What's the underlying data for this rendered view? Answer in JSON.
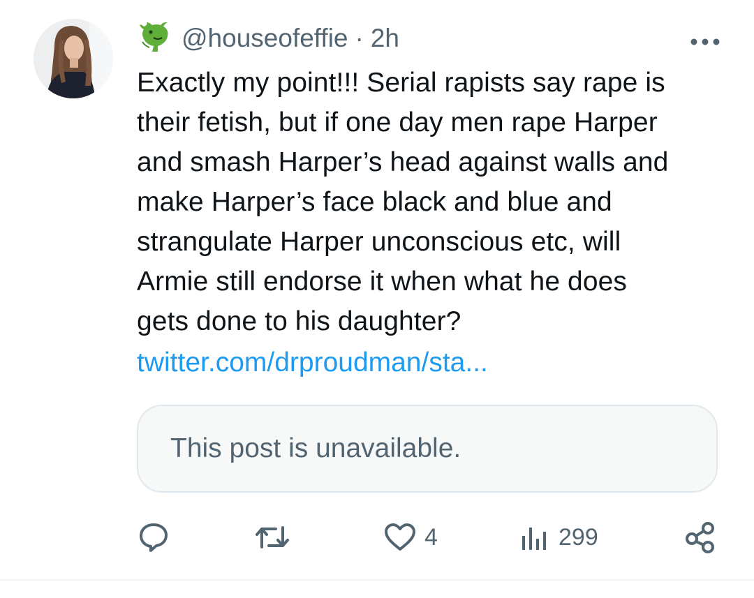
{
  "tweet": {
    "handle": "@houseofeffie",
    "separator": "·",
    "time": "2h",
    "emoji_icon": "dragon-face-icon",
    "text": "Exactly my point!!! Serial rapists say rape is\ntheir fetish, but if one day men rape Harper\nand smash Harper’s head against walls and\nmake Harper’s face black and blue and\nstrangulate Harper unconscious etc, will\nArmie still endorse it when what he does\ngets done to his daughter?",
    "link": "twitter.com/drproudman/sta...",
    "quote_unavailable": "This post is unavailable."
  },
  "actions": {
    "reply": {
      "icon": "reply-bubble-icon",
      "count": ""
    },
    "retweet": {
      "icon": "retweet-icon",
      "count": ""
    },
    "like": {
      "icon": "heart-icon",
      "count": "4"
    },
    "views": {
      "icon": "views-bar-icon",
      "count": "299"
    },
    "share": {
      "icon": "share-nodes-icon"
    }
  },
  "colors": {
    "text": "#0f1419",
    "secondary": "#536471",
    "link": "#1d9bf0",
    "quote_bg": "#f7f9f9",
    "border": "#e1e8ed"
  }
}
